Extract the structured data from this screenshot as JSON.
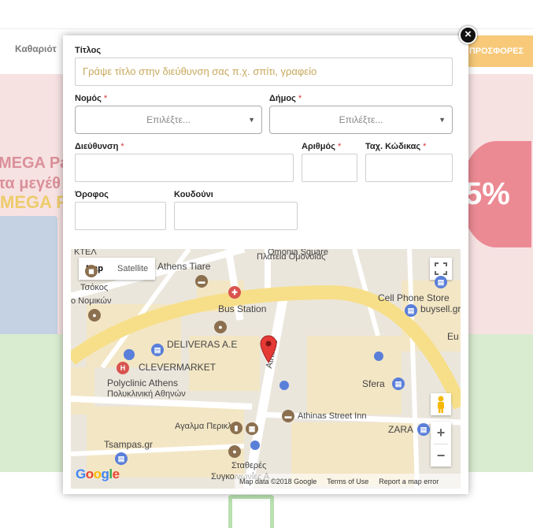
{
  "background": {
    "nav_item": "Καθαριότ",
    "offers_label": "ΠΡΟΣΦΟΡΕΣ",
    "promo_line1": "MEGA Pac",
    "promo_line2": "τα μεγέθ",
    "pack_label": "MEGA Pa",
    "percent": "5%"
  },
  "form": {
    "title_label": "Τίτλος",
    "title_placeholder": "Γράψε τίτλο στην διεύθυνση σας π.χ. σπίτι, γραφείο",
    "prefecture_label": "Νομός",
    "municipality_label": "Δήμος",
    "required_mark": "*",
    "select_placeholder": "Επιλέξτε...",
    "address_label": "Διεύθυνση",
    "number_label": "Αριθμός",
    "zip_label": "Ταχ. Κώδικας",
    "floor_label": "Όροφος",
    "doorbell_label": "Κουδούνι"
  },
  "map": {
    "map_type_options": [
      "Map",
      "Satellite"
    ],
    "selected_map_type": "Map",
    "labels": {
      "ktel": "ΚΤΕΛ",
      "omonia_gr1": "Omonia Square",
      "omonia_gr2": "Πλατεία Ομονοίας",
      "athens_tiare": "Athens Tiare",
      "tsokos": "Τσόκος",
      "nomikon": "ο Νομικών",
      "bus_station": "Bus Station",
      "cell_phone_store": "Cell Phone Store",
      "buysell": "buysell.gr",
      "eu": "Eu",
      "deliveras": "DELIVERAS A.E",
      "clevermarket": "CLEVERMARKET",
      "polyclinic1": "Polyclinic Athens",
      "polyclinic2": "Πολυκλινική Αθηνών",
      "athinas_street": "Athinas",
      "sfera": "Sfera",
      "athinas_inn": "Athinas Street Inn",
      "agalma": "Αγαλμα Περικλή",
      "zara": "ZARA",
      "tsampas": "Tsampas.gr",
      "stathmos1": "Σταθερές",
      "stathmos2": "Συγκοινωνίες Α"
    },
    "logo": "Google",
    "map_data": "Map data ©2018 Google",
    "terms": "Terms of Use",
    "report": "Report a map error",
    "zoom_in": "+",
    "zoom_out": "−"
  }
}
